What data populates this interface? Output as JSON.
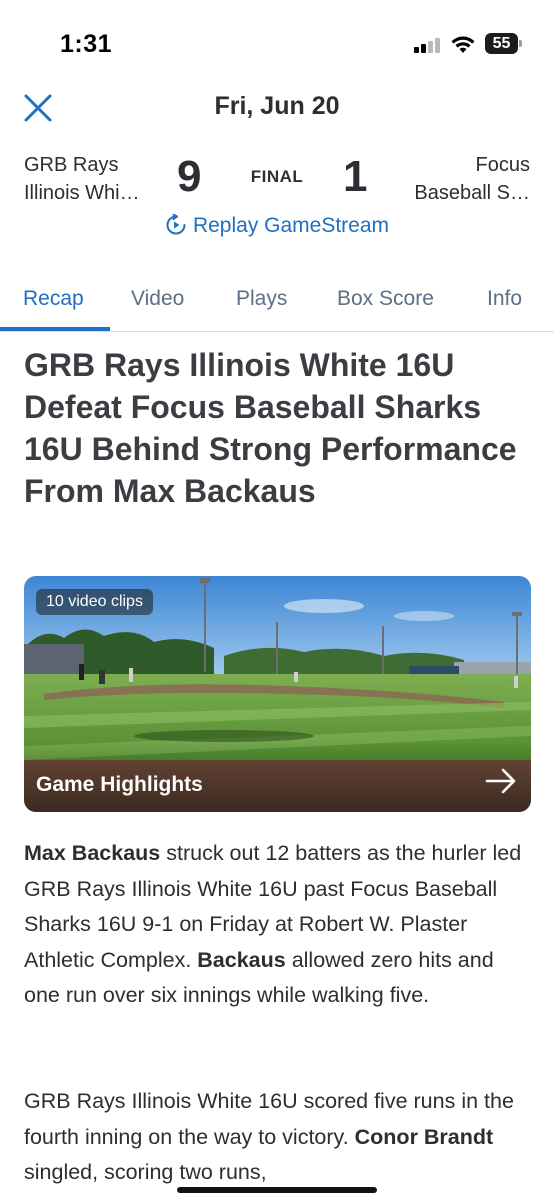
{
  "status_bar": {
    "time": "1:31",
    "battery_level": "55"
  },
  "header": {
    "date": "Fri, Jun 20",
    "close_icon": "close-icon"
  },
  "scoreboard": {
    "home_team_line1": "GRB Rays",
    "home_team_line2": "Illinois Whi…",
    "home_score": "9",
    "status": "FINAL",
    "away_score": "1",
    "away_team_line1": "Focus",
    "away_team_line2": "Baseball S…",
    "replay_label": "Replay GameStream"
  },
  "tabs": [
    {
      "label": "Recap",
      "active": true
    },
    {
      "label": "Video",
      "active": false
    },
    {
      "label": "Plays",
      "active": false
    },
    {
      "label": "Box Score",
      "active": false
    },
    {
      "label": "Info",
      "active": false
    }
  ],
  "article": {
    "headline": "GRB Rays Illinois White 16U Defeat Focus Baseball Sharks 16U Behind Strong Performance From Max Backaus",
    "video": {
      "badge": "10 video clips",
      "title": "Game Highlights"
    },
    "para1": {
      "name1": "Max Backaus",
      "text1": " struck out 12 batters as the hurler led GRB Rays Illinois White 16U past Focus Baseball Sharks 16U 9-1 on Friday at Robert W. Plaster Athletic Complex. ",
      "name2": "Backaus",
      "text2": " allowed zero hits and one run over six innings while walking five."
    },
    "para2": {
      "text1": "GRB Rays Illinois White 16U scored five runs in the fourth inning on the way to victory. ",
      "name1": "Conor Brandt",
      "text2": " singled, scoring two runs,"
    }
  },
  "colors": {
    "accent": "#1f6fc4",
    "text": "#2b2e33",
    "tab_inactive": "#5b6f86"
  }
}
